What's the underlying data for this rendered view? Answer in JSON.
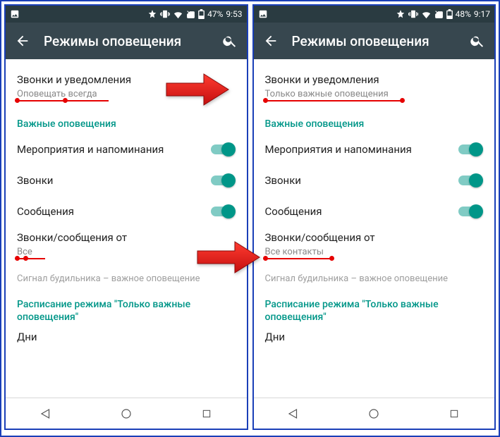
{
  "left": {
    "status": {
      "battery": "47%",
      "time": "9:53"
    },
    "title": "Режимы оповещения",
    "callsNotifications": {
      "title": "Звонки и уведомления",
      "sub": "Оповещать всегда"
    },
    "section1": "Важные оповещения",
    "events": "Мероприятия и напоминания",
    "calls": "Звонки",
    "messages": "Сообщения",
    "from": {
      "title": "Звонки/сообщения от",
      "sub": "Все"
    },
    "note": "Сигнал будильника – важное оповещение",
    "section2": "Расписание режима \"Только важные оповещения\"",
    "days": "Дни"
  },
  "right": {
    "status": {
      "battery": "48%",
      "time": "9:17"
    },
    "title": "Режимы оповещения",
    "callsNotifications": {
      "title": "Звонки и уведомления",
      "sub": "Только важные оповещения"
    },
    "section1": "Важные оповещения",
    "events": "Мероприятия и напоминания",
    "calls": "Звонки",
    "messages": "Сообщения",
    "from": {
      "title": "Звонки/сообщения от",
      "sub": "Все контакты"
    },
    "note": "Сигнал будильника – важное оповещение",
    "section2": "Расписание режима \"Только важные оповещения\"",
    "days": "Дни"
  }
}
